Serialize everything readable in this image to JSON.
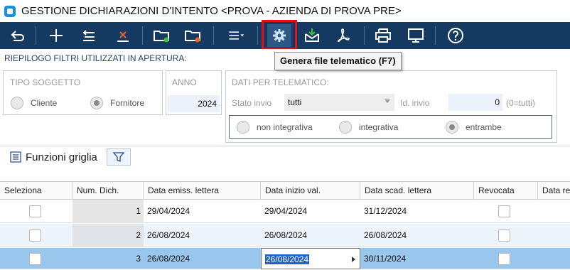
{
  "window": {
    "title": "GESTIONE DICHIARAZIONI D'INTENTO <PROVA - AZIENDA DI PROVA PRE>"
  },
  "toolbar": {
    "buttons": [
      {
        "name": "undo-icon"
      },
      {
        "name": "add-icon"
      },
      {
        "name": "edit-icon"
      },
      {
        "name": "delete-icon"
      },
      {
        "name": "folder-green-icon"
      },
      {
        "name": "folder-orange-icon"
      },
      {
        "name": "menu-icon"
      },
      {
        "name": "gear-icon"
      },
      {
        "name": "download-icon"
      },
      {
        "name": "pdf-icon"
      },
      {
        "name": "print-icon"
      },
      {
        "name": "monitor-icon"
      },
      {
        "name": "help-icon"
      }
    ],
    "tooltip": "Genera file telematico (F7)"
  },
  "filters": {
    "title": "RIEPILOGO FILTRI UTILIZZATI IN APERTURA:",
    "tipo_soggetto": {
      "label": "TIPO SOGGETTO",
      "options": [
        {
          "label": "Cliente",
          "checked": false
        },
        {
          "label": "Fornitore",
          "checked": true
        }
      ]
    },
    "anno": {
      "label": "ANNO",
      "value": "2024"
    },
    "dati_telematico": {
      "label": "DATI PER TELEMATICO:",
      "stato_invio_label": "Stato invio",
      "stato_invio_value": "tutti",
      "id_invio_label": "Id. invio",
      "id_invio_value": "0",
      "id_invio_hint": "(0=tutti)",
      "options": [
        {
          "label": "non integrativa",
          "checked": false
        },
        {
          "label": "integrativa",
          "checked": false
        },
        {
          "label": "entrambe",
          "checked": true
        }
      ]
    }
  },
  "grid_tools": {
    "funzioni_label": "Funzioni griglia"
  },
  "grid": {
    "columns": [
      "Seleziona",
      "Num. Dich.",
      "Data emiss. lettera",
      "Data inizio val.",
      "Data scad. lettera",
      "Revocata",
      "Data re"
    ],
    "rows": [
      {
        "num": "1",
        "emiss": "29/04/2024",
        "inizio": "29/04/2024",
        "scad": "31/12/2024"
      },
      {
        "num": "2",
        "emiss": "26/08/2024",
        "inizio": "26/08/2024",
        "scad": "26/08/2024"
      },
      {
        "num": "3",
        "emiss": "26/08/2024",
        "inizio": "26/08/2024",
        "scad": "30/11/2024"
      }
    ]
  }
}
